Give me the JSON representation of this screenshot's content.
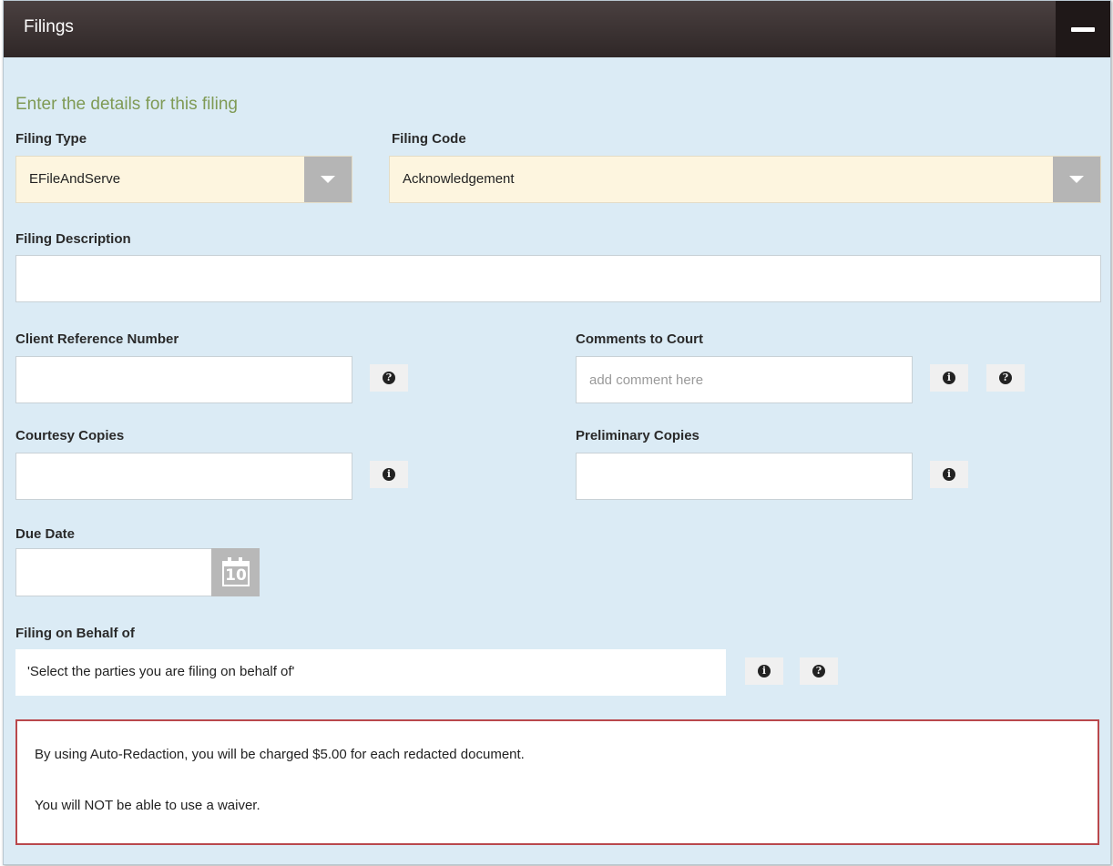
{
  "header": {
    "title": "Filings"
  },
  "form": {
    "subtitle": "Enter the details for this filing",
    "filing_type": {
      "label": "Filing Type",
      "value": "EFileAndServe"
    },
    "filing_code": {
      "label": "Filing Code",
      "value": "Acknowledgement"
    },
    "filing_description": {
      "label": "Filing Description",
      "value": ""
    },
    "client_reference": {
      "label": "Client Reference Number",
      "value": ""
    },
    "comments": {
      "label": "Comments to Court",
      "placeholder": "add comment here",
      "value": ""
    },
    "courtesy_copies": {
      "label": "Courtesy Copies",
      "value": ""
    },
    "preliminary_copies": {
      "label": "Preliminary Copies",
      "value": ""
    },
    "due_date": {
      "label": "Due Date",
      "value": "",
      "calendar_day": "10"
    },
    "filing_on_behalf": {
      "label": "Filing on Behalf of",
      "placeholder": "'Select the parties you are filing on behalf of'"
    }
  },
  "notice": {
    "line1": "By using Auto-Redaction, you will be charged $5.00 for each redacted document.",
    "line2": "You will NOT be able to use a waiver.",
    "border_color": "#b9484c"
  },
  "icons": {
    "info": "info-icon",
    "help": "question-icon",
    "calendar": "calendar-icon",
    "collapse": "minus-icon"
  }
}
